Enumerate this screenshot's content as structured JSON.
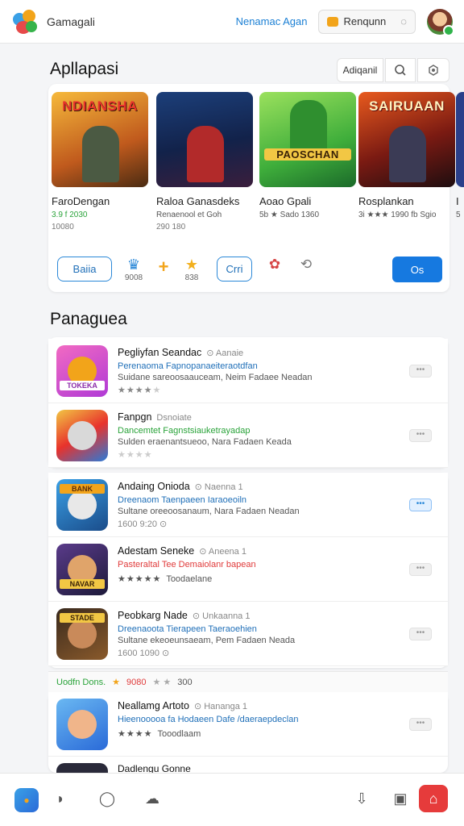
{
  "header": {
    "app_name": "Gamagali",
    "link": "Nenamac Agan",
    "button_label": "Renqunn",
    "colors": {
      "accent": "#1a7fd4"
    }
  },
  "section1": {
    "title": "Apllapasi",
    "filter_label": "Adiqanil",
    "games": [
      {
        "cover_title": "NDIANSHA",
        "name": "FaroDengan",
        "meta": "3.9 f 2030",
        "meta2": "10080"
      },
      {
        "cover_title": "",
        "name": "Raloa Ganasdeks",
        "meta": "Renaenool et Goh",
        "meta2": "290 180"
      },
      {
        "cover_title": "PAOSCHAN",
        "name": "Aoao Gpali",
        "meta": "5b ★ Sado 1360",
        "meta2": ""
      },
      {
        "cover_title": "SAIRUAAN",
        "name": "Rosplankan",
        "meta": "3i ★★★ 1990 fb Sgio",
        "meta2": ""
      },
      {
        "cover_title": "",
        "name": "I",
        "meta": "5",
        "meta2": ""
      }
    ],
    "actions": {
      "pill1": "Baiia",
      "mini1": "9008",
      "mini2": "838",
      "pill2": "Crri",
      "primary": "Os"
    }
  },
  "section2": {
    "title": "Panaguea",
    "rows": [
      {
        "title": "Pegliyfan Seandac",
        "sub": "⊙ Aanaie",
        "line2": "Perenaoma Fapnopanaeiteraotdfan",
        "line2_color": "#1f6fb8",
        "line3": "Suidane sareoosaauceam, Neim Fadaee Neadan",
        "stars": "★★★★",
        "stars_off": "★",
        "line4": ""
      },
      {
        "title": "Fanpgn",
        "sub": "Dsnoiate",
        "line2": "Dancemtet Fagnstsiauketrayadap",
        "line2_color": "#2aa33a",
        "line3": "Sulden eraenantsueoo, Nara Fadaen Keada",
        "stars": "",
        "stars_off": "★★★★",
        "line4": ""
      },
      {
        "title": "Andaing Onioda",
        "sub": "⊙ Naenna 1",
        "line2": "Dreenaom Taenpaeen Iaraoeoiln",
        "line2_color": "#1f6fb8",
        "line3": "Sultane oreeoosanaum, Nara Fadaen Neadan",
        "stars": "",
        "stars_off": "",
        "line4": "1600 9:20 ⊙"
      },
      {
        "title": "Adestam Seneke",
        "sub": "⊙ Aneena 1",
        "line2": "Pasteraltal Tee Demaiolanr bapean",
        "line2_color": "#e03b3b",
        "line3": "",
        "stars": "★★★★★",
        "stars_off": "",
        "line4": "Toodaelane"
      },
      {
        "title": "Peobkarg Nade",
        "sub": "⊙ Unkaanna 1",
        "line2": "Dreenaoota Tierapeen Taeraoehien",
        "line2_color": "#1f6fb8",
        "line3": "Sultane ekeoeunsaeam, Pem Fadaen Neada",
        "stars": "",
        "stars_off": "",
        "line4": "1600 1090 ⊙"
      },
      {
        "title": "Neallamg Artoto",
        "sub": "⊙ Hananga 1",
        "line2": "Hieenooooa fa Hodaeen Dafe /daeraepdeclan",
        "line2_color": "#1f6fb8",
        "line3": "",
        "stars": "★★★★",
        "stars_off": "",
        "line4": "Tooodlaam"
      }
    ],
    "strip": {
      "label": "Uodfn Dons.",
      "rating": "9080",
      "count": "300"
    }
  },
  "footer": {
    "partial_title": "Dadlengu Gonne"
  }
}
